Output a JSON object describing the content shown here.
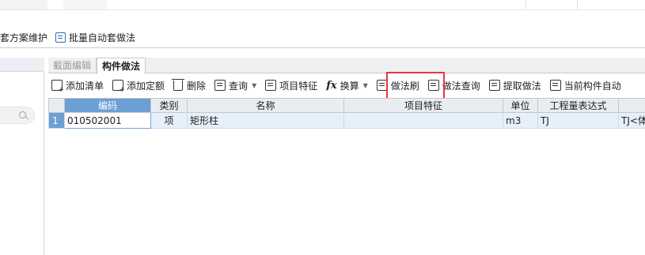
{
  "ribbon": {
    "item1_label": "套方案维护",
    "item2_label": "批量自动套做法"
  },
  "tabs": [
    {
      "label": "截面编辑"
    },
    {
      "label": "构件做法"
    }
  ],
  "toolbar": {
    "add_list": "添加清单",
    "add_quota": "添加定额",
    "delete": "删除",
    "query": "查询",
    "item_feature": "项目特征",
    "convert": "换算",
    "method_brush": "做法刷",
    "method_query": "做法查询",
    "extract_method": "提取做法",
    "current_auto": "当前构件自动"
  },
  "table": {
    "headers": [
      "编码",
      "类别",
      "名称",
      "项目特征",
      "单位",
      "工程量表达式",
      ""
    ],
    "rows": [
      {
        "num": "1",
        "code": "010502001",
        "type": "项",
        "name": "矩形柱",
        "feature": "",
        "unit": "m3",
        "expr": "TJ",
        "extra": "TJ<体"
      }
    ]
  },
  "colors": {
    "accent_blue": "#6b9fd6",
    "highlight_red": "#e23a3a"
  }
}
